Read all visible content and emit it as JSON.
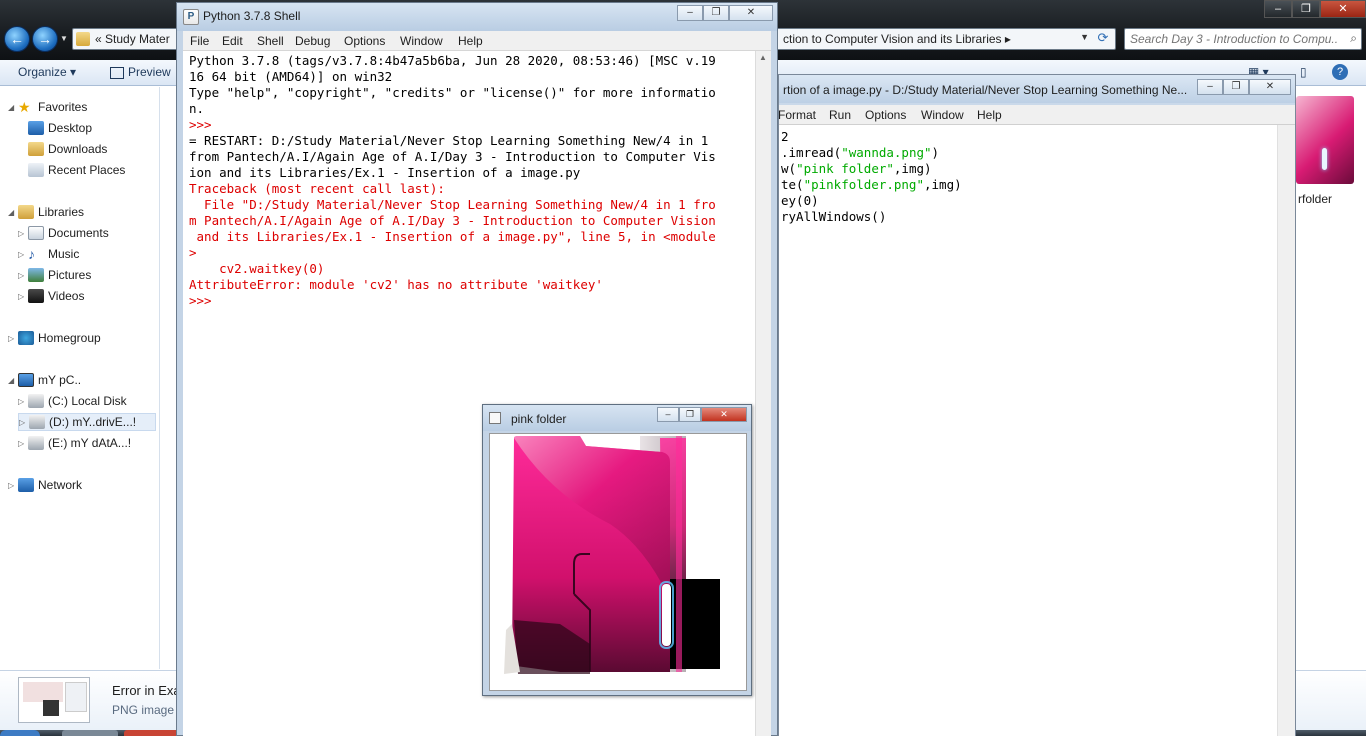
{
  "explorer": {
    "address": {
      "crumb_start": "«  Study Mater",
      "crumb_end": "ction to Computer Vision and its Libraries  ▸"
    },
    "search_placeholder": "Search Day 3 - Introduction to Compu...",
    "toolbar": {
      "organize": "Organize ▾",
      "preview": "Preview"
    },
    "nav": {
      "favorites": "Favorites",
      "desktop": "Desktop",
      "downloads": "Downloads",
      "recent_places": "Recent Places",
      "libraries": "Libraries",
      "documents": "Documents",
      "music": "Music",
      "pictures": "Pictures",
      "videos": "Videos",
      "homegroup": "Homegroup",
      "computer": "mY pC..",
      "drive_c": "(C:) Local Disk",
      "drive_d": "(D:) mY..drivE...!",
      "drive_e": "(E:) mY dAtA...!",
      "network": "Network"
    },
    "right_file_label": "rfolder",
    "details": {
      "name": "Error in Exa",
      "type": "PNG image"
    }
  },
  "editor": {
    "title": "rtion of a image.py - D:/Study Material/Never Stop Learning Something Ne...",
    "menu": {
      "format": "Format",
      "run": "Run",
      "options": "Options",
      "window": "Window",
      "help": "Help"
    },
    "code": {
      "l1": "2",
      "l2a": ".imread(",
      "l2s": "\"wannda.png\"",
      "l2b": ")",
      "l3a": "w(",
      "l3s": "\"pink folder\"",
      "l3b": ",img)",
      "l4a": "te(",
      "l4s": "\"pinkfolder.png\"",
      "l4b": ",img)",
      "l5": "ey(0)",
      "l6": "ryAllWindows()"
    }
  },
  "shell": {
    "title": "Python 3.7.8 Shell",
    "menu": {
      "file": "File",
      "edit": "Edit",
      "shell": "Shell",
      "debug": "Debug",
      "options": "Options",
      "window": "Window",
      "help": "Help"
    },
    "lines": [
      "Python 3.7.8 (tags/v3.7.8:4b47a5b6ba, Jun 28 2020, 08:53:46) [MSC v.19",
      "16 64 bit (AMD64)] on win32",
      "Type \"help\", \"copyright\", \"credits\" or \"license()\" for more informatio",
      "n.",
      ">>> ",
      "= RESTART: D:/Study Material/Never Stop Learning Something New/4 in 1",
      "from Pantech/A.I/Again Age of A.I/Day 3 - Introduction to Computer Vis",
      "ion and its Libraries/Ex.1 - Insertion of a image.py",
      "Traceback (most recent call last):",
      "  File \"D:/Study Material/Never Stop Learning Something New/4 in 1 fro",
      "m Pantech/A.I/Again Age of A.I/Day 3 - Introduction to Computer Vision",
      " and its Libraries/Ex.1 - Insertion of a image.py\", line 5, in <module",
      ">",
      "    cv2.waitkey(0)",
      "AttributeError: module 'cv2' has no attribute 'waitkey'",
      ">>> "
    ]
  },
  "image_window": {
    "title": "pink folder"
  },
  "colors": {
    "error_red": "#dd0000",
    "prompt_red": "#dd0000",
    "string_green": "#00aa00",
    "folder_pink": "#e0157a"
  }
}
